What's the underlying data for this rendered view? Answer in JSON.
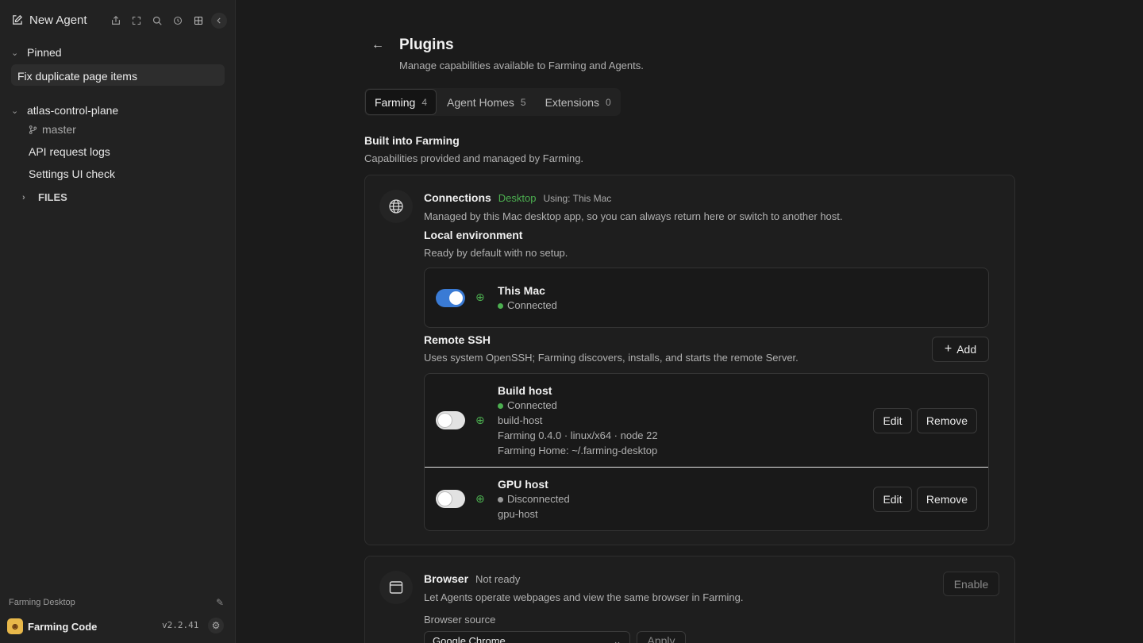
{
  "sidebar": {
    "new_agent": "New Agent",
    "pinned_label": "Pinned",
    "pinned_item": "Fix duplicate page items",
    "project": "atlas-control-plane",
    "branch": "master",
    "items": [
      "API request logs",
      "Settings UI check"
    ],
    "files_label": "FILES",
    "footer_label": "Farming Desktop",
    "app_name": "Farming Code",
    "version": "v2.2.41"
  },
  "page": {
    "title": "Plugins",
    "subtitle": "Manage capabilities available to Farming and Agents.",
    "tabs": [
      {
        "label": "Farming",
        "count": "4"
      },
      {
        "label": "Agent Homes",
        "count": "5"
      },
      {
        "label": "Extensions",
        "count": "0"
      }
    ],
    "section_title": "Built into Farming",
    "section_sub": "Capabilities provided and managed by Farming."
  },
  "connections": {
    "name": "Connections",
    "badge": "Desktop",
    "using": "Using: This Mac",
    "desc": "Managed by this Mac desktop app, so you can always return here or switch to another host.",
    "local_title": "Local environment",
    "local_sub": "Ready by default with no setup.",
    "this_mac": {
      "name": "This Mac",
      "status": "Connected",
      "enabled": true
    },
    "remote_title": "Remote SSH",
    "remote_sub": "Uses system OpenSSH; Farming discovers, installs, and starts the remote Server.",
    "add_label": "Add",
    "hosts": [
      {
        "name": "Build host",
        "status": "Connected",
        "alias": "build-host",
        "details": "Farming 0.4.0 · linux/x64 · node 22",
        "home": "Farming Home: ~/.farming-desktop",
        "enabled": false
      },
      {
        "name": "GPU host",
        "status": "Disconnected",
        "alias": "gpu-host",
        "enabled": false
      }
    ],
    "edit_label": "Edit",
    "remove_label": "Remove"
  },
  "browser": {
    "name": "Browser",
    "status": "Not ready",
    "desc": "Let Agents operate webpages and view the same browser in Farming.",
    "source_label": "Browser source",
    "source_value": "Google Chrome",
    "apply_label": "Apply",
    "enable_label": "Enable"
  },
  "colors": {
    "accent": "#3a7bd5",
    "connected": "#4caf50",
    "disconnected": "#9a9a9a"
  }
}
